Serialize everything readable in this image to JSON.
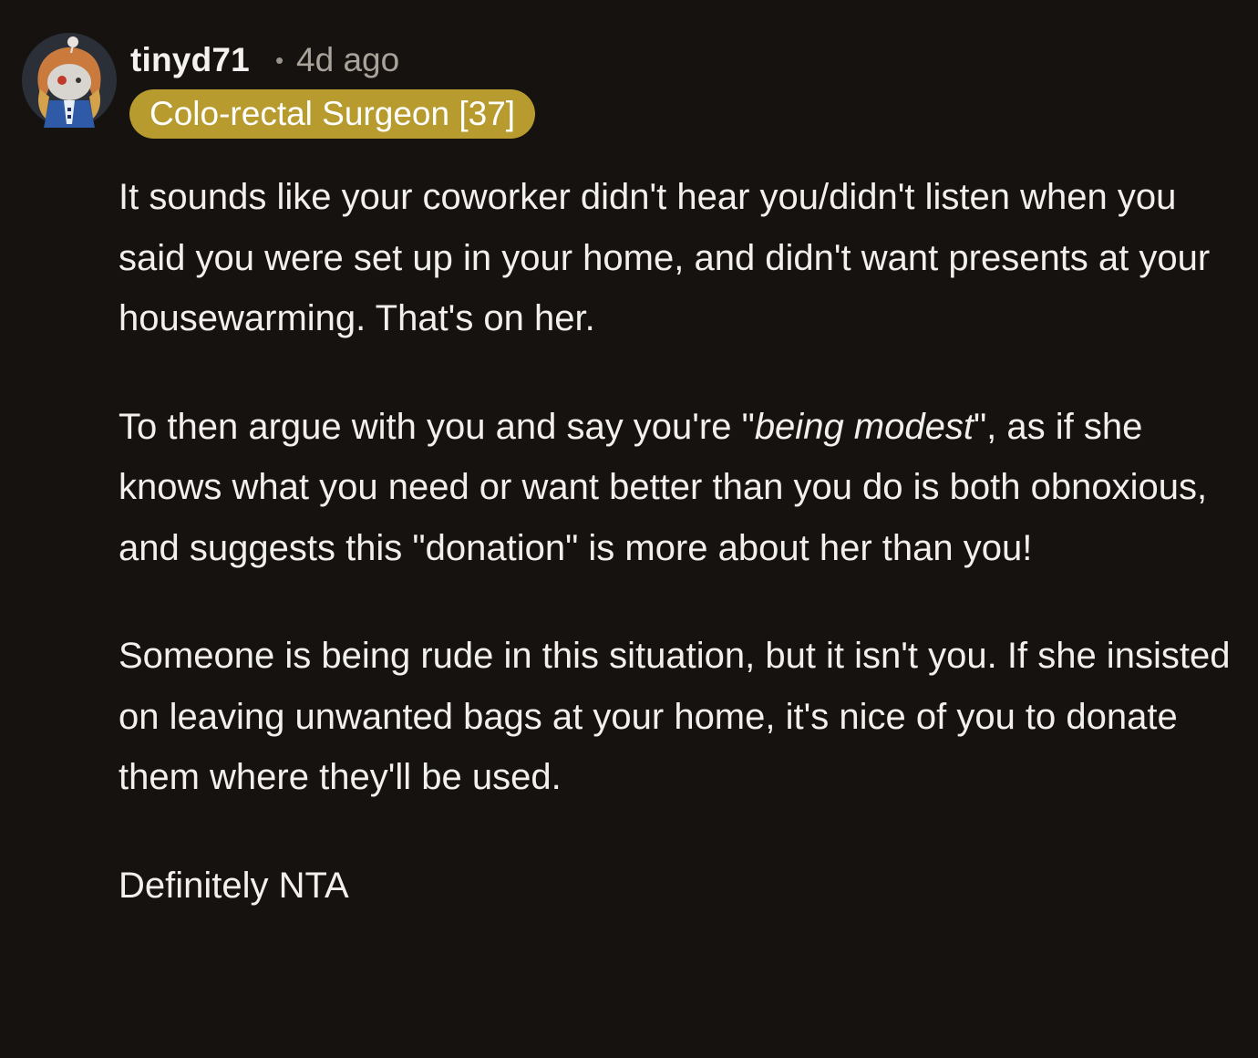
{
  "comment": {
    "username": "tinyd71",
    "separator": "•",
    "timestamp": "4d ago",
    "flair": "Colo-rectal Surgeon [37]",
    "avatar_icon": "user-avatar-icon",
    "flair_color": "#b89b2f",
    "background_color": "#16120f",
    "paragraphs": [
      {
        "text": "It sounds like your coworker didn't hear you/didn't listen when you said you were set up in your home, and didn't want presents at your housewarming. That's on her."
      },
      {
        "before": "To then argue with you and say you're \"",
        "emphasis": "being modest",
        "after": "\", as if she knows what you need or want better than you do is both obnoxious, and suggests this \"donation\" is more about her than you!"
      },
      {
        "text": "Someone is being rude in this situation, but it isn't you. If she insisted on leaving unwanted bags at your home, it's nice of you to donate them where they'll be used."
      },
      {
        "text": "Definitely NTA"
      }
    ]
  }
}
